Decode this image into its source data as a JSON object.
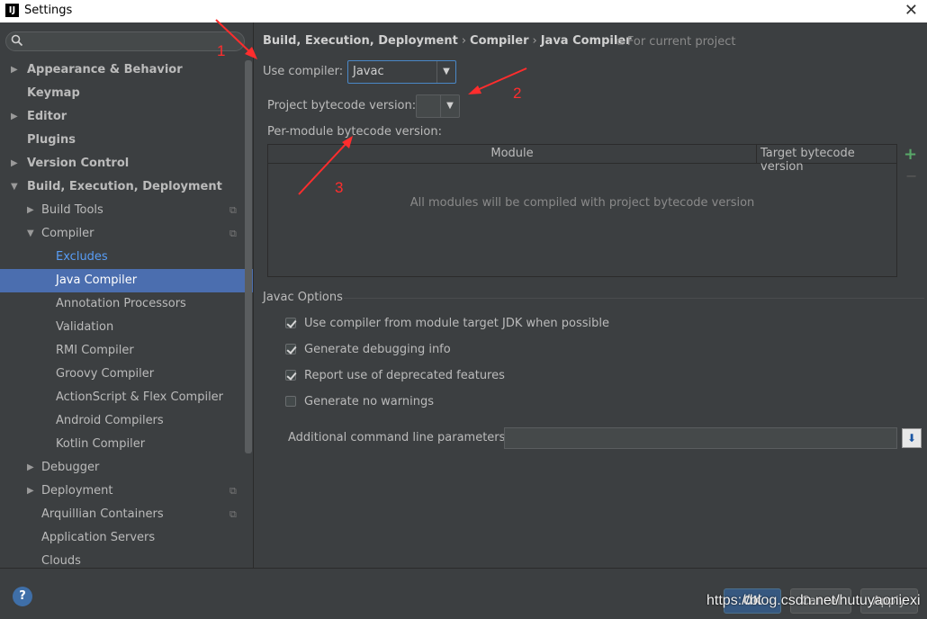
{
  "window": {
    "title": "Settings",
    "app_icon": "IJ"
  },
  "search": {
    "placeholder": ""
  },
  "sidebar": {
    "items": [
      {
        "label": "Appearance & Behavior"
      },
      {
        "label": "Keymap"
      },
      {
        "label": "Editor"
      },
      {
        "label": "Plugins"
      },
      {
        "label": "Version Control"
      },
      {
        "label": "Build, Execution, Deployment"
      },
      {
        "label": "Build Tools"
      },
      {
        "label": "Compiler"
      },
      {
        "label": "Excludes"
      },
      {
        "label": "Java Compiler"
      },
      {
        "label": "Annotation Processors"
      },
      {
        "label": "Validation"
      },
      {
        "label": "RMI Compiler"
      },
      {
        "label": "Groovy Compiler"
      },
      {
        "label": "ActionScript & Flex Compiler"
      },
      {
        "label": "Android Compilers"
      },
      {
        "label": "Kotlin Compiler"
      },
      {
        "label": "Debugger"
      },
      {
        "label": "Deployment"
      },
      {
        "label": "Arquillian Containers"
      },
      {
        "label": "Application Servers"
      },
      {
        "label": "Clouds"
      }
    ]
  },
  "breadcrumb": {
    "part1": "Build, Execution, Deployment",
    "sep": "›",
    "part2": "Compiler",
    "part3": "Java Compiler"
  },
  "scope_note": "For current project",
  "use_compiler": {
    "label": "Use compiler:",
    "value": "Javac"
  },
  "bytecode": {
    "label": "Project bytecode version:",
    "value": ""
  },
  "per_module": {
    "label": "Per-module bytecode version:",
    "columns": [
      "Module",
      "Target bytecode version"
    ],
    "empty_text": "All modules will be compiled with project bytecode version"
  },
  "javac_options": {
    "title": "Javac Options",
    "checkboxes": [
      {
        "label": "Use compiler from module target JDK when possible",
        "checked": true
      },
      {
        "label": "Generate debugging info",
        "checked": true
      },
      {
        "label": "Report use of deprecated features",
        "checked": true
      },
      {
        "label": "Generate no warnings",
        "checked": false
      }
    ],
    "additional_label": "Additional command line parameters:",
    "additional_value": ""
  },
  "buttons": {
    "ok": "OK",
    "cancel": "Cancel",
    "apply": "Apply",
    "help": "?"
  },
  "annotations": [
    "1",
    "2",
    "3"
  ],
  "watermark": "https://blog.csdn.net/hutuyaoniexi",
  "colors": {
    "selection": "#4b6eaf",
    "link": "#589df6",
    "annotation": "#ff2d2d",
    "add": "#59a869"
  }
}
